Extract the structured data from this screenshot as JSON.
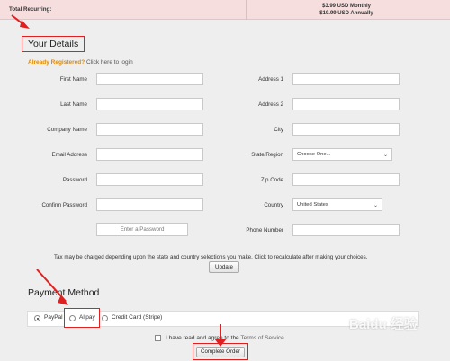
{
  "summary": {
    "total_label": "Total Recurring:",
    "monthly": "$3.99 USD Monthly",
    "annually": "$19.99 USD Annually"
  },
  "details": {
    "title": "Your Details",
    "already_registered": "Already Registered?",
    "login_link": "Click here to login"
  },
  "form": {
    "first_name": "First Name",
    "last_name": "Last Name",
    "company_name": "Company Name",
    "email": "Email Address",
    "password": "Password",
    "confirm_password": "Confirm Password",
    "password_btn": "Enter a Password",
    "address1": "Address 1",
    "address2": "Address 2",
    "city": "City",
    "state": "State/Region",
    "state_value": "Choose One...",
    "zip": "Zip Code",
    "country": "Country",
    "country_value": "United States",
    "phone": "Phone Number"
  },
  "tax": {
    "note": "Tax may be charged depending upon the state and country selections you make. Click to recalculate after making your choices.",
    "update_label": "Update"
  },
  "payment": {
    "title": "Payment Method",
    "paypal": "PayPal",
    "alipay": "Alipay",
    "stripe": "Credit Card (Stripe)"
  },
  "tos": {
    "text": "I have read and agree to the",
    "link": "Terms of Service"
  },
  "complete_label": "Complete Order",
  "colors": {
    "annotation": "#e02020",
    "already_registered": "#e08a00"
  },
  "watermark": "Baidu 经验"
}
